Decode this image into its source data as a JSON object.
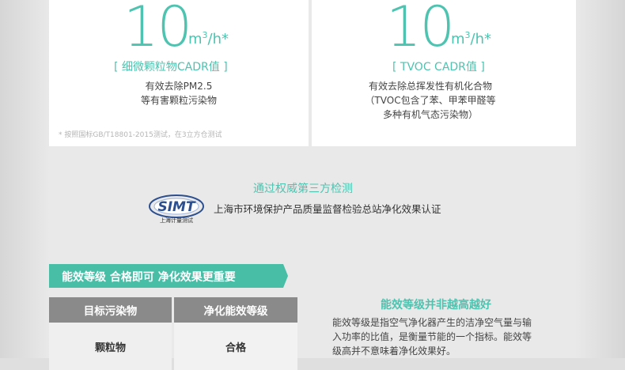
{
  "left_card": {
    "value": "10",
    "unit": "m³/h*",
    "tag": "[ 细微颗粒物CADR值 ]",
    "desc_line1": "有效去除PM2.5",
    "desc_line2": "等有害颗粒污染物",
    "note": "* 按照国标GB/T18801-2015测试，在3立方仓测试"
  },
  "right_card": {
    "value": "10",
    "unit": "m³/h*",
    "tag": "[ TVOC CADR值 ]",
    "desc_line1": "有效去除总挥发性有机化合物",
    "desc_line2": "（TVOC包含了苯、甲苯甲醛等",
    "desc_line3": "多种有机气态污染物）"
  },
  "certification": {
    "title": "通过权威第三方检测",
    "logo_text": "SIMT",
    "logo_subtext": "上海计量测试",
    "text": "上海市环境保护产品质量监督检验总站净化效果认证"
  },
  "banner": {
    "text": "能效等级 合格即可 净化效果更重要"
  },
  "table": {
    "headers": [
      "目标污染物",
      "净化能效等级"
    ],
    "rows": [
      [
        "颗粒物",
        "合格"
      ]
    ]
  },
  "explanation": {
    "title": "能效等级并非越高越好",
    "body_line1": "能效等级是指空气净化器产生的洁净空气量与输",
    "body_line2": "入功率的比值，是衡量节能的一个指标。能效等",
    "body_line3": "级高并不意味着净化效果好。"
  },
  "colors": {
    "accent": "#4ec3b0",
    "banner": "#49bea7",
    "table_header": "#8a8a8a"
  }
}
